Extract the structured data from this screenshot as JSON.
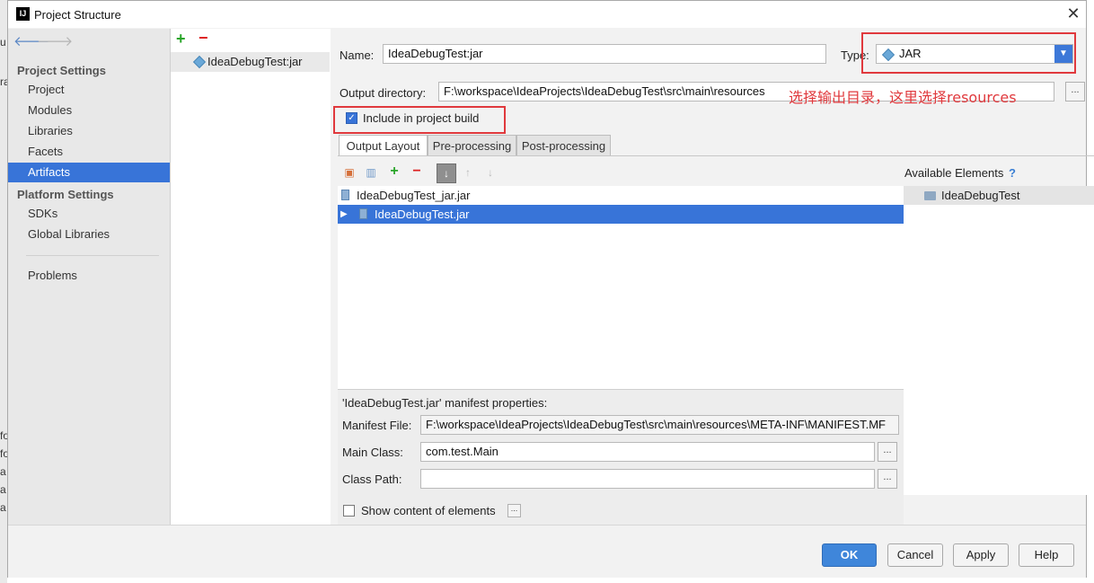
{
  "background_left_text": [
    "u",
    "ra",
    "fo",
    "fo",
    "a",
    "a",
    "a"
  ],
  "window": {
    "title": "Project Structure"
  },
  "nav": {
    "project_settings_header": "Project Settings",
    "project_items": [
      "Project",
      "Modules",
      "Libraries",
      "Facets",
      "Artifacts"
    ],
    "platform_settings_header": "Platform Settings",
    "platform_items": [
      "SDKs",
      "Global Libraries"
    ],
    "problems": "Problems",
    "selected": "Artifacts"
  },
  "artifacts": {
    "items": [
      "IdeaDebugTest:jar"
    ]
  },
  "form": {
    "name_label": "Name:",
    "name_value": "IdeaDebugTest:jar",
    "type_label": "Type:",
    "type_value": "JAR",
    "output_dir_label": "Output directory:",
    "output_dir_value": "F:\\workspace\\IdeaProjects\\IdeaDebugTest\\src\\main\\resources",
    "annotation": "选择输出目录，这里选择resources",
    "include_build_label": "Include in project build",
    "include_build_checked": true
  },
  "tabs": [
    "Output Layout",
    "Pre-processing",
    "Post-processing"
  ],
  "active_tab": "Output Layout",
  "output_tree": [
    "IdeaDebugTest_jar.jar",
    "IdeaDebugTest.jar"
  ],
  "available": {
    "header": "Available Elements",
    "help": "?",
    "items": [
      "IdeaDebugTest"
    ]
  },
  "manifest": {
    "title": "'IdeaDebugTest.jar' manifest properties:",
    "file_label": "Manifest File:",
    "file_value": "F:\\workspace\\IdeaProjects\\IdeaDebugTest\\src\\main\\resources\\META-INF\\MANIFEST.MF",
    "main_class_label": "Main Class:",
    "main_class_value": "com.test.Main",
    "class_path_label": "Class Path:",
    "class_path_value": ""
  },
  "show_content_label": "Show content of elements",
  "browse_label": "...",
  "buttons": {
    "ok": "OK",
    "cancel": "Cancel",
    "apply": "Apply",
    "help": "Help"
  },
  "colors": {
    "selection": "#3874d8",
    "annotation_red": "#e0393d",
    "add_green": "#2aa52a",
    "remove_red": "#dd2222"
  }
}
